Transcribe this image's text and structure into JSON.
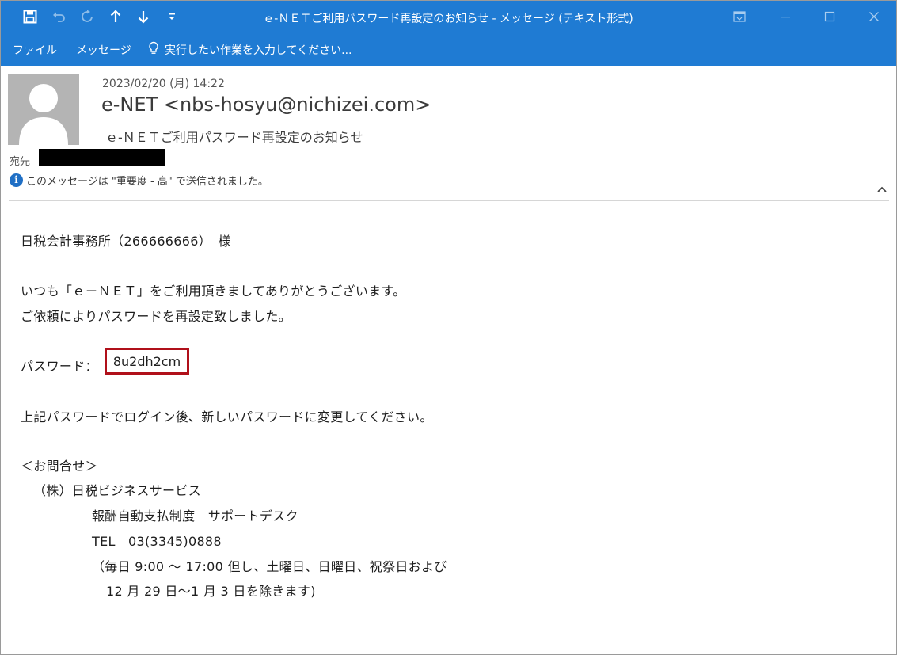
{
  "window": {
    "title": "ｅ-ＮＥＴご利用パスワード再設定のお知らせ - メッセージ (テキスト形式)"
  },
  "quick_access": {
    "save_icon": "save-icon",
    "undo_icon": "undo-icon",
    "redo_icon": "redo-icon",
    "previous_icon": "arrow-up-icon",
    "next_icon": "arrow-down-icon",
    "customize_icon": "customize-dropdown-icon"
  },
  "ribbon": {
    "tabs": [
      "ファイル",
      "メッセージ"
    ],
    "tell_me": "実行したい作業を入力してください..."
  },
  "header": {
    "date": "2023/02/20 (月) 14:22",
    "sender": "e-NET <nbs-hosyu@nichizei.com>",
    "subject": "ｅ-ＮＥＴご利用パスワード再設定のお知らせ",
    "to_label": "宛先",
    "importance_note": "このメッセージは \"重要度 - 高\" で送信されました。"
  },
  "body": {
    "lines": [
      "日税会計事務所（266666666）　様",
      "いつも「ｅ－ＮＥＴ」をご利用頂きましてありがとうございます。",
      "ご依頼によりパスワードを再設定致しました。",
      "パスワード：",
      "上記パスワードでログイン後、新しいパスワードに変更してください。",
      "＜お問合せ＞",
      "（株）日税ビジネスサービス",
      "報酬自動支払制度　サポートデスク",
      "TEL　03(3345)0888",
      "（毎日 9:00 ～ 17:00 但し、土曜日、日曜日、祝祭日および",
      "12 月 29 日～1 月 3 日を除きます)"
    ],
    "password": "8u2dh2cm"
  },
  "colors": {
    "titlebar": "#1f7bd3",
    "highlight_border": "#b0101a",
    "info_icon": "#1f6fc5"
  }
}
